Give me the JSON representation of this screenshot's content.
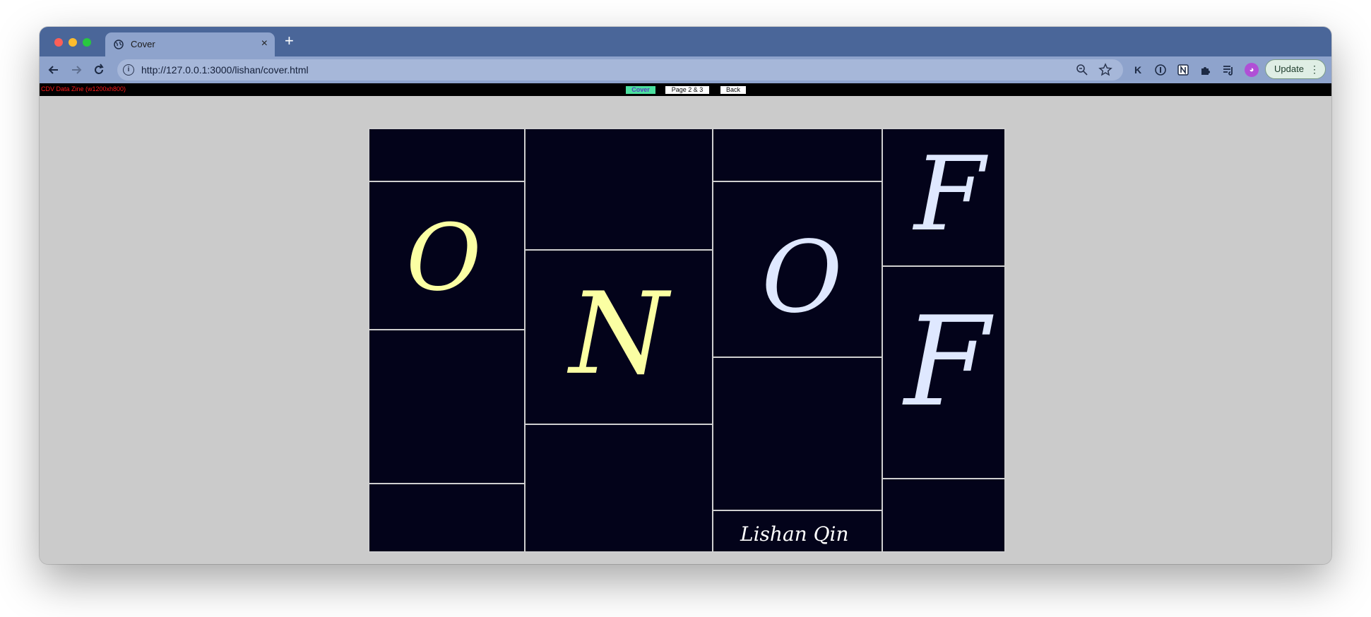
{
  "browser": {
    "tab_title": "Cover",
    "tab_close": "×",
    "new_tab": "+",
    "url": "http://127.0.0.1:3000/lishan/cover.html",
    "update_label": "Update",
    "update_menu": "⋮",
    "icons": [
      "back-icon",
      "forward-icon",
      "reload-icon",
      "info-icon",
      "zoom-icon",
      "star-icon",
      "k-extension-icon",
      "password-icon",
      "notion-icon",
      "puzzle-extension-icon",
      "reading-list-icon",
      "profile-avatar-icon"
    ]
  },
  "page": {
    "zine_label": "CDV Data Zine (w1200xh800)",
    "nav": {
      "cover": "Cover",
      "pages_2_3": "Page 2 & 3",
      "back": "Back"
    },
    "cover": {
      "letters": {
        "o1": "O",
        "n": "N",
        "o2": "O",
        "f1": "F",
        "f2": "F"
      },
      "signature": "Lishan Qin",
      "colors": {
        "background": "#03031a",
        "yellow_letters": "#fbffa3",
        "blue_letters": "#dfe8ff",
        "cell_border": "#cfcfcf"
      }
    }
  }
}
